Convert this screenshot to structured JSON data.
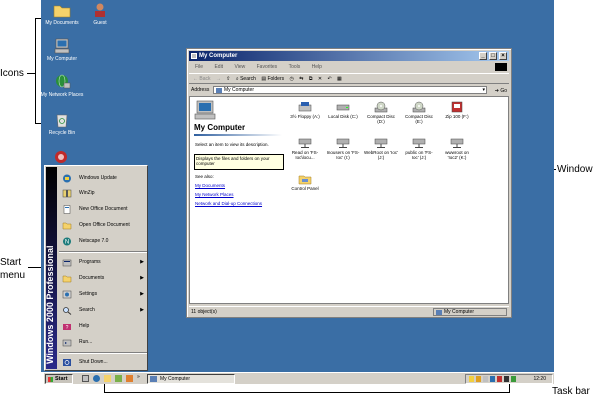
{
  "annotations": {
    "icons": "Icons",
    "window": "Window",
    "start_menu_line1": "Start",
    "start_menu_line2": "menu",
    "task_bar": "Task bar"
  },
  "desktop_icons": [
    {
      "label": "My Documents",
      "icon": "folder-icon"
    },
    {
      "label": "Guest",
      "icon": "user-icon"
    },
    {
      "label": "My Computer",
      "icon": "computer-icon"
    },
    {
      "label": "My Network Places",
      "icon": "network-icon"
    },
    {
      "label": "Recycle Bin",
      "icon": "recycle-bin-icon"
    }
  ],
  "window": {
    "title": "My Computer",
    "menu": [
      "File",
      "Edit",
      "View",
      "Favorites",
      "Tools",
      "Help"
    ],
    "toolbar": {
      "back": "Back",
      "search": "Search",
      "folders": "Folders"
    },
    "address_label": "Address",
    "address_value": "My Computer",
    "go_label": "Go",
    "left_pane": {
      "heading": "My Computer",
      "hint": "Select an item to view its description.",
      "tooltip": "Displays the files and folders on your computer",
      "see_also": "See also:",
      "links": [
        "My Documents",
        "My Network Places",
        "Network and Dial-up Connections"
      ]
    },
    "items": [
      {
        "label": "3½ Floppy (A:)",
        "icon": "floppy-icon"
      },
      {
        "label": "Local Disk (C:)",
        "icon": "harddisk-icon"
      },
      {
        "label": "Compact Disc (D:)",
        "icon": "cd-icon"
      },
      {
        "label": "Compact Disc (E:)",
        "icon": "cd-icon"
      },
      {
        "label": "Zip 100 (F:)",
        "icon": "zip-drive-icon"
      },
      {
        "label": "Read on 'FS-Ioc\\locu...",
        "icon": "network-drive-icon"
      },
      {
        "label": "Inousers on 'FS-Ioc' (I:)",
        "icon": "network-drive-icon"
      },
      {
        "label": "WebRoot on 'Ioc' (J:)",
        "icon": "network-drive-icon"
      },
      {
        "label": "public on 'FS-Ioc' (J:)",
        "icon": "network-drive-icon"
      },
      {
        "label": "wwwroot on 'Ioc2' (K:)",
        "icon": "network-drive-icon"
      },
      {
        "label": "Control Panel",
        "icon": "control-panel-icon"
      }
    ],
    "status_left": "11 object(s)",
    "status_right": "My Computer"
  },
  "start_menu": {
    "sidebar_text": "Windows 2000 Professional",
    "items": [
      {
        "label": "Windows Update",
        "icon": "windows-update-icon",
        "submenu": false
      },
      {
        "label": "WinZip",
        "icon": "winzip-icon",
        "submenu": false
      },
      {
        "label": "New Office Document",
        "icon": "new-office-doc-icon",
        "submenu": false
      },
      {
        "label": "Open Office Document",
        "icon": "open-office-doc-icon",
        "submenu": false
      },
      {
        "label": "Netscape 7.0",
        "icon": "netscape-icon",
        "submenu": false
      },
      {
        "label": "Programs",
        "icon": "programs-icon",
        "submenu": true
      },
      {
        "label": "Documents",
        "icon": "documents-icon",
        "submenu": true
      },
      {
        "label": "Settings",
        "icon": "settings-icon",
        "submenu": true
      },
      {
        "label": "Search",
        "icon": "search-icon",
        "submenu": true
      },
      {
        "label": "Help",
        "icon": "help-icon",
        "submenu": false
      },
      {
        "label": "Run...",
        "icon": "run-icon",
        "submenu": false
      },
      {
        "label": "Shut Down...",
        "icon": "shutdown-icon",
        "submenu": false
      }
    ]
  },
  "taskbar": {
    "start_label": "Start",
    "task_label": "My Computer",
    "clock": "12:20"
  },
  "colors": {
    "desktop": "#3a6ea5",
    "titlebar_start": "#0a246a",
    "titlebar_end": "#a6caf0",
    "chrome": "#d4d0c8"
  }
}
